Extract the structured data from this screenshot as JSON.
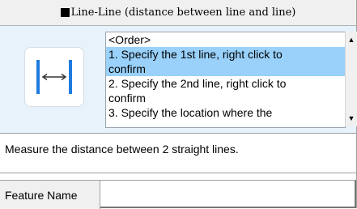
{
  "title_bar": {
    "title": "Line-Line (distance between line and line)"
  },
  "guide": {
    "icon": "line-to-line-distance-icon",
    "steps": [
      "<Order>",
      "1. Specify the 1st line, right click to",
      "confirm",
      "2. Specify the 2nd line, right click to",
      "confirm",
      "3. Specify the location where the"
    ],
    "selected_step": 1
  },
  "description": "Measure the distance between 2 straight lines.",
  "feature_name": {
    "label": "Feature Name",
    "value": ""
  },
  "colors": {
    "guide_background": "#e7f2fb",
    "selection": "#99d1fb",
    "icon_blue": "#1e7be0"
  }
}
